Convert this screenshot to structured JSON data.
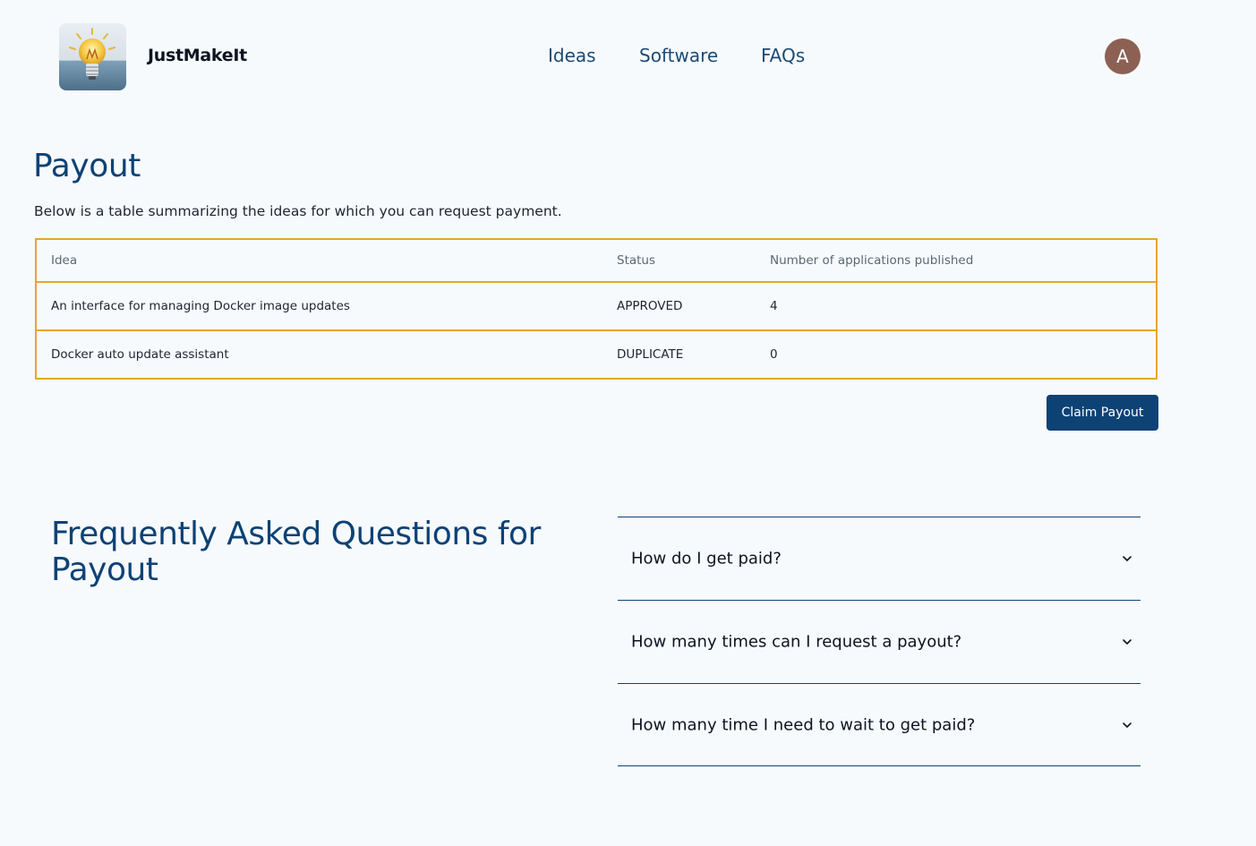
{
  "header": {
    "brand": "JustMakeIt",
    "logo_icon": "lightbulb-icon",
    "nav": [
      {
        "label": "Ideas"
      },
      {
        "label": "Software"
      },
      {
        "label": "FAQs"
      }
    ],
    "avatar_initial": "A",
    "avatar_color": "#8c6154"
  },
  "main": {
    "title": "Payout",
    "description": "Below is a table summarizing the ideas for which you can request payment.",
    "table": {
      "border_color": "#e3a82c",
      "headers": [
        "Idea",
        "Status",
        "Number of applications published"
      ],
      "rows": [
        {
          "idea": "An interface for managing Docker image updates",
          "status": "APPROVED",
          "apps": "4"
        },
        {
          "idea": "Docker auto update assistant",
          "status": "DUPLICATE",
          "apps": "0"
        }
      ]
    },
    "claim_label": "Claim Payout",
    "accent_color": "#0d4275"
  },
  "faq": {
    "title": "Frequently Asked Questions for Payout",
    "items": [
      {
        "question": "How do I get paid?",
        "icon": "chevron-down-icon"
      },
      {
        "question": "How many times can I request a payout?",
        "icon": "chevron-down-icon"
      },
      {
        "question": "How many time I need to wait to get paid?",
        "icon": "chevron-down-icon"
      }
    ]
  }
}
